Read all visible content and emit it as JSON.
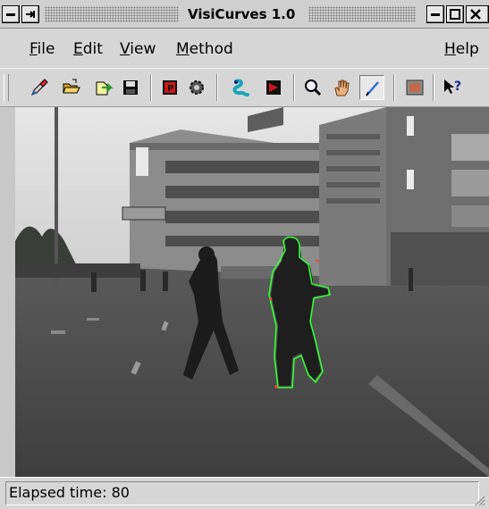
{
  "window": {
    "title": "VisiCurves 1.0",
    "controls": [
      "minimize-icon",
      "maximize-icon",
      "close-icon"
    ]
  },
  "menubar": {
    "items": [
      {
        "label": "File",
        "mnemonic": "F",
        "rest": "ile"
      },
      {
        "label": "Edit",
        "mnemonic": "E",
        "rest": "dit"
      },
      {
        "label": "View",
        "mnemonic": "V",
        "rest": "iew"
      },
      {
        "label": "Method",
        "mnemonic": "M",
        "rest": "ethod"
      },
      {
        "label": "Help",
        "mnemonic": "H",
        "rest": "elp"
      }
    ]
  },
  "toolbar": {
    "tools": [
      "new-pencil-icon",
      "open-folder-icon",
      "load-image-icon",
      "save-icon",
      "parking-stop-icon",
      "settings-gear-icon",
      "snake-icon",
      "play-run-icon",
      "zoom-icon",
      "pan-hand-icon",
      "draw-pen-icon",
      "view-image-icon",
      "context-help-icon"
    ],
    "active_tool": "draw-pen-icon"
  },
  "canvas": {
    "content": "street-scene-with-pedestrian-contour",
    "contour_color": "#33ff33"
  },
  "statusbar": {
    "text": "Elapsed time: 80"
  }
}
